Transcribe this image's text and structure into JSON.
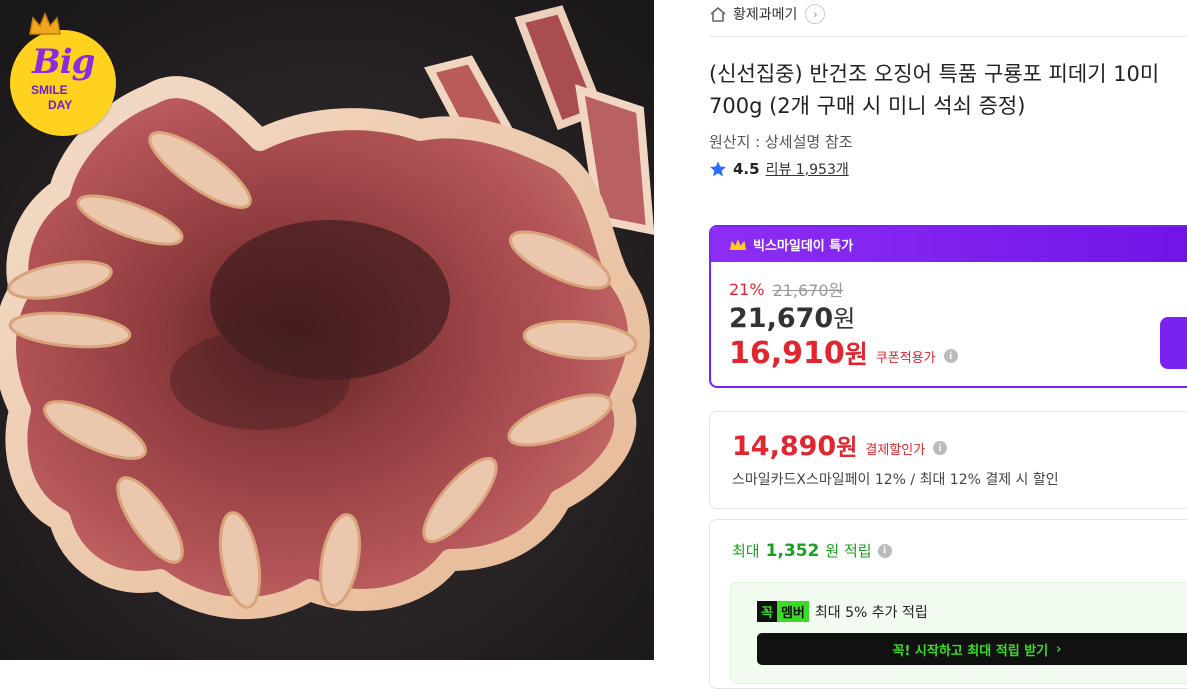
{
  "promo_badge": {
    "big": "Big",
    "smile": "SMILE",
    "day": "DAY",
    "crown_icon": "crown-icon"
  },
  "store": {
    "name": "황제과메기",
    "home_icon": "home-icon",
    "chevron_icon": "chevron-right-icon"
  },
  "product": {
    "title_line1": "(신선집중) 반건조 오징어 특품 구룡포 피데기 10미",
    "title_line2": "700g (2개 구매 시 미니 석쇠 증정)",
    "origin": "원산지 : 상세설명 참조",
    "rating": "4.5",
    "review_label": "리뷰",
    "review_count": "1,953개",
    "star_icon": "star-icon"
  },
  "deal": {
    "header": "빅스마일데이 특가",
    "discount_rate": "21%",
    "original_price": "21,670원",
    "sale_price": "21,670",
    "sale_won": "원",
    "coupon_price": "16,910",
    "coupon_won": "원",
    "coupon_label": "쿠폰적용가",
    "accent_color": "#7a22f0"
  },
  "payment": {
    "price": "14,890",
    "won": "원",
    "label": "결제할인가",
    "description": "스마일카드X스마일페이 12% / 최대 12% 결제 시 할인"
  },
  "points": {
    "prefix": "최대",
    "amount": "1,352",
    "suffix": "원 적립",
    "member_tag_1": "꼭",
    "member_tag_2": "멤버",
    "member_text": "최대 5% 추가 적립",
    "member_button": "꼭! 시작하고 최대 적립 받기",
    "member_button_arrow": "›",
    "accent_color": "#18a11e"
  },
  "info_icon_glyph": "i"
}
